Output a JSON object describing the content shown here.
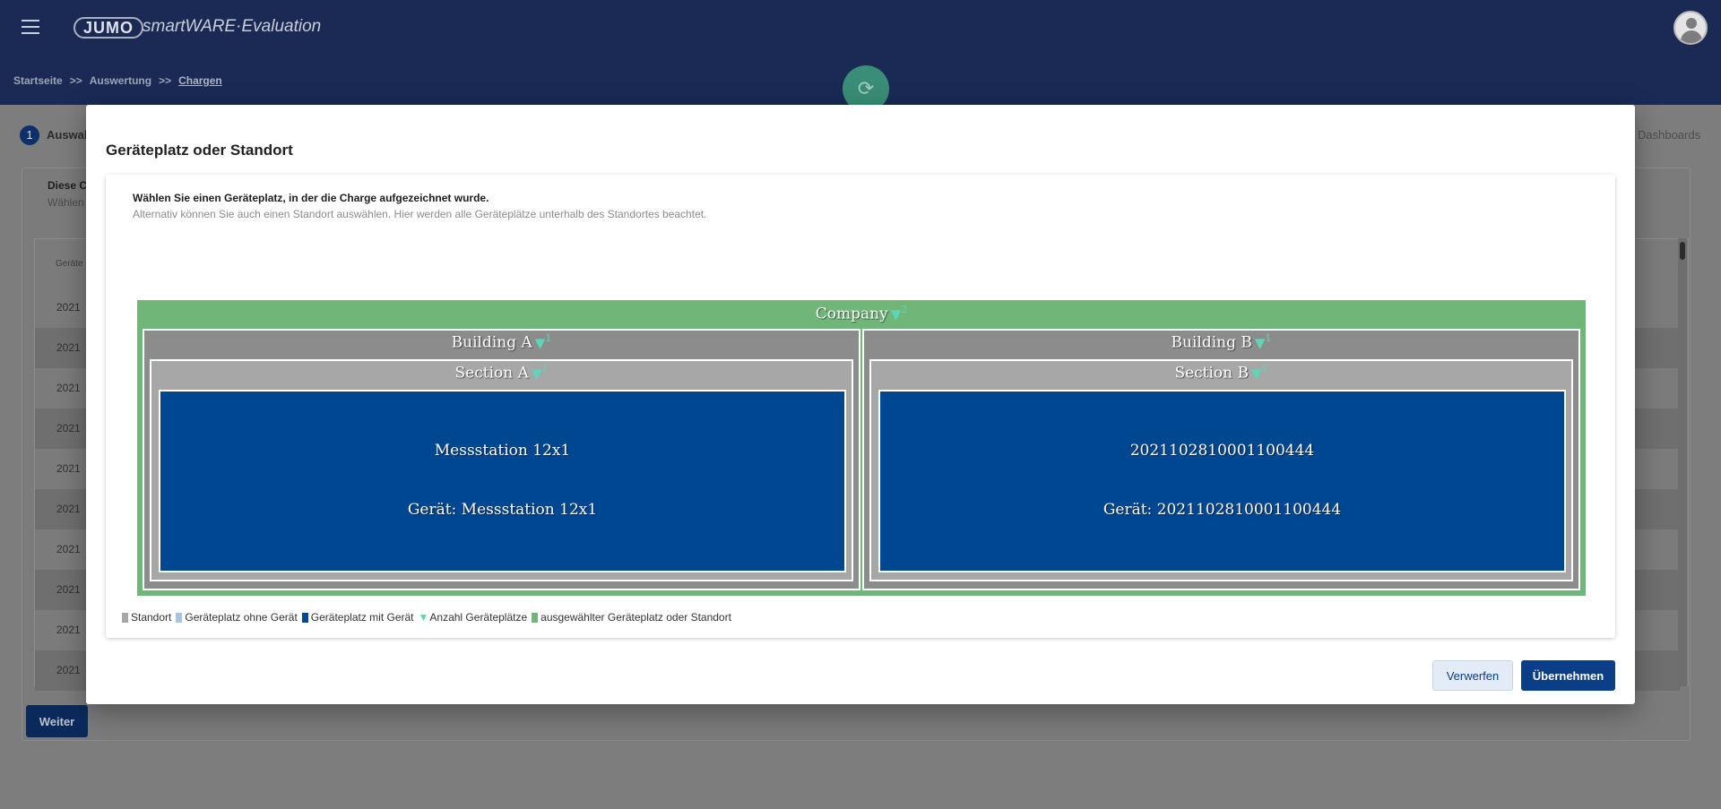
{
  "app": {
    "logo_text": "JUMO",
    "title": "smartWARE·Evaluation",
    "menu_icon": "hamburger-icon",
    "avatar_icon": "user-avatar-icon"
  },
  "breadcrumb": {
    "items": [
      "Startseite",
      "Auswertung",
      "Chargen"
    ],
    "separator": ">>"
  },
  "refresh_icon": "⟳",
  "background": {
    "step_number": "1",
    "step_label": "Auswahl",
    "right_link": "Dashboards",
    "card_title": "Diese C",
    "card_subtitle": "Wählen",
    "table_header": "Geräte",
    "rows": [
      "2021",
      "2021",
      "2021",
      "2021",
      "2021",
      "2021",
      "2021",
      "2021",
      "2021",
      "2021"
    ],
    "next_button": "Weiter"
  },
  "modal": {
    "title": "Geräteplatz oder Standort",
    "instruction": "Wählen Sie einen Geräteplatz, in der die Charge aufgezeichnet wurde.",
    "hint": "Alternativ können Sie auch einen Standort auswählen. Hier werden alle Geräteplätze unterhalb des Standortes beachtet.",
    "tree": {
      "root": {
        "name": "Company",
        "count": "2"
      },
      "buildings": [
        {
          "name": "Building A",
          "count": "1",
          "section": {
            "name": "Section A",
            "count": "1",
            "device": {
              "name": "Messstation 12x1",
              "label": "Gerät: Messstation 12x1"
            }
          }
        },
        {
          "name": "Building B",
          "count": "1",
          "section": {
            "name": "Section B",
            "count": "1",
            "device": {
              "name": "2021102810001100444",
              "label": "Gerät: 2021102810001100444"
            }
          }
        }
      ],
      "count_glyph": "▼"
    },
    "legend": [
      {
        "label": "Standort",
        "color": "#a7a7a7",
        "type": "square"
      },
      {
        "label": "Geräteplatz ohne Gerät",
        "color": "#a7c3df",
        "type": "square"
      },
      {
        "label": "Geräteplatz mit Gerät",
        "color": "#004792",
        "type": "square"
      },
      {
        "label": "Anzahl Geräteplätze",
        "color": "#5fd5b8",
        "type": "triangle"
      },
      {
        "label": "ausgewählter Geräteplatz oder Standort",
        "color": "#70b678",
        "type": "square"
      }
    ],
    "buttons": {
      "discard": "Verwerfen",
      "apply": "Übernehmen"
    }
  }
}
